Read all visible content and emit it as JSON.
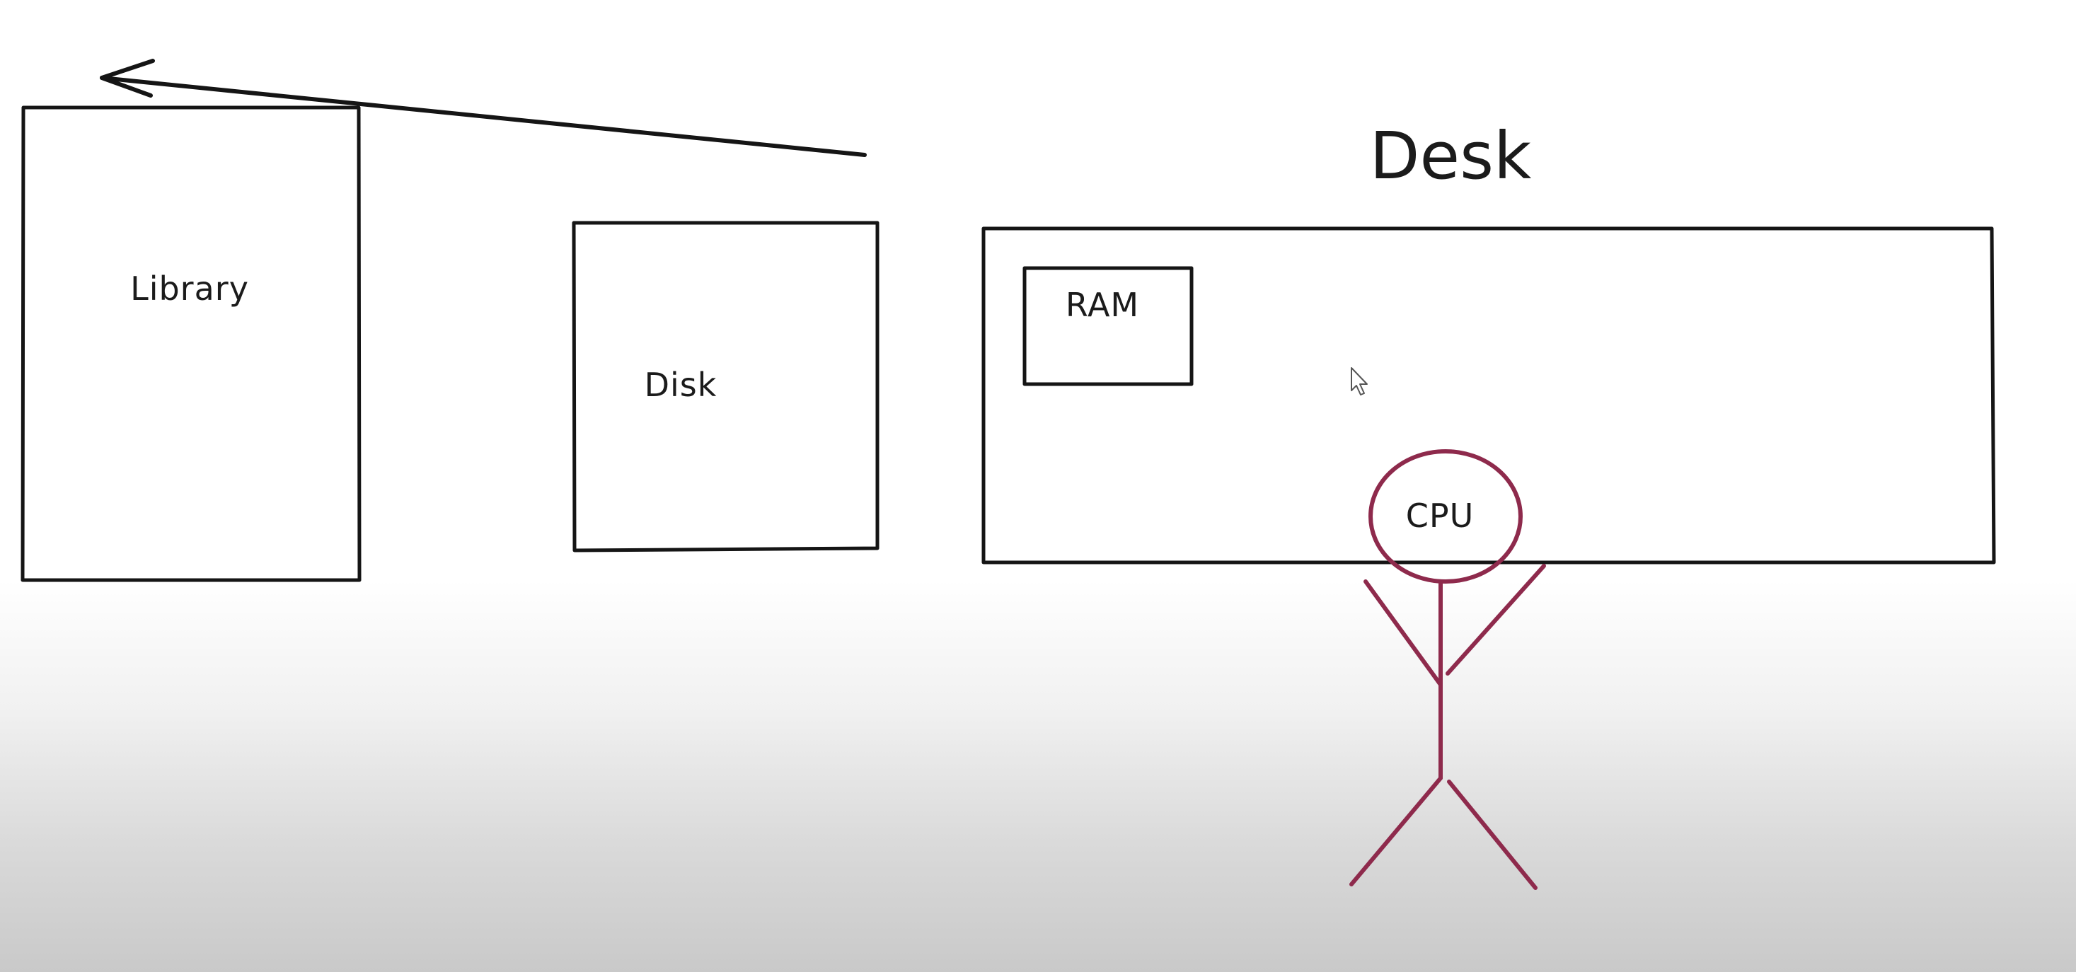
{
  "diagram": {
    "title": "Desk",
    "library_label": "Library",
    "disk_label": "Disk",
    "ram_label": "RAM",
    "cpu_label": "CPU"
  },
  "colors": {
    "ink": "#151515",
    "cpu_figure": "#8e2a4c"
  },
  "icons": {
    "cursor": "mouse-pointer-icon",
    "arrow": "left-arrow"
  }
}
